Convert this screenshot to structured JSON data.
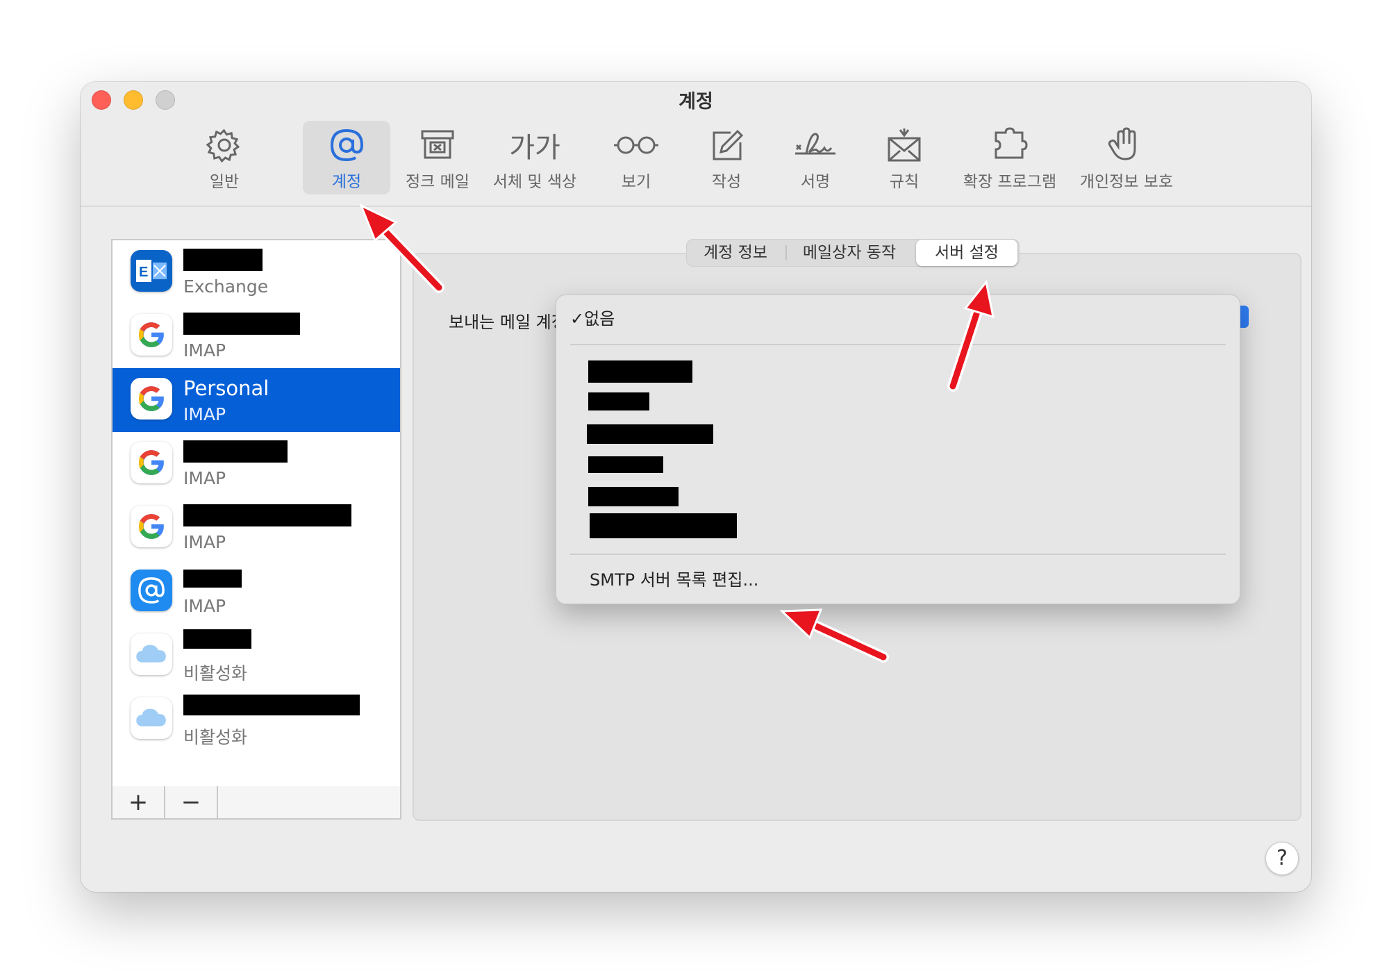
{
  "window": {
    "title": "계정"
  },
  "toolbar": {
    "items": [
      {
        "label": "일반",
        "icon": "gear-icon"
      },
      {
        "label": "계정",
        "icon": "at-sign-icon"
      },
      {
        "label": "정크 메일",
        "icon": "junk-box-icon"
      },
      {
        "label": "서체 및 색상",
        "icon": "font-icon",
        "glyph": "가가"
      },
      {
        "label": "보기",
        "icon": "glasses-icon"
      },
      {
        "label": "작성",
        "icon": "compose-icon"
      },
      {
        "label": "서명",
        "icon": "signature-icon"
      },
      {
        "label": "규칙",
        "icon": "envelope-rules-icon"
      },
      {
        "label": "확장 프로그램",
        "icon": "puzzle-icon"
      },
      {
        "label": "개인정보 보호",
        "icon": "hand-icon"
      }
    ],
    "active": "계정"
  },
  "accounts": [
    {
      "name": "",
      "type": "Exchange",
      "icon": "exchange-icon"
    },
    {
      "name": "",
      "type": "IMAP",
      "icon": "google-icon"
    },
    {
      "name": "Personal",
      "type": "IMAP",
      "icon": "google-icon",
      "selected": true
    },
    {
      "name": "",
      "type": "IMAP",
      "icon": "google-icon"
    },
    {
      "name": "",
      "type": "IMAP",
      "icon": "google-icon"
    },
    {
      "name": "",
      "type": "IMAP",
      "icon": "at-mail-icon"
    },
    {
      "name": "",
      "type": "비활성화",
      "icon": "icloud-icon"
    },
    {
      "name": "",
      "type": "비활성화",
      "icon": "icloud-icon"
    }
  ],
  "list_footer": {
    "add": "+",
    "remove": "−"
  },
  "tabs": [
    {
      "label": "계정 정보"
    },
    {
      "label": "메일상자 동작"
    },
    {
      "label": "서버 설정",
      "active": true
    }
  ],
  "server": {
    "send_label": "보내는 메일 계정"
  },
  "dropdown": {
    "checkmark": "✓",
    "selected": "없음",
    "edit_item": "SMTP 서버 목록 편집..."
  },
  "help": "?",
  "colors": {
    "accent": "#0560d8",
    "annotation_arrow": "#e8141e"
  }
}
